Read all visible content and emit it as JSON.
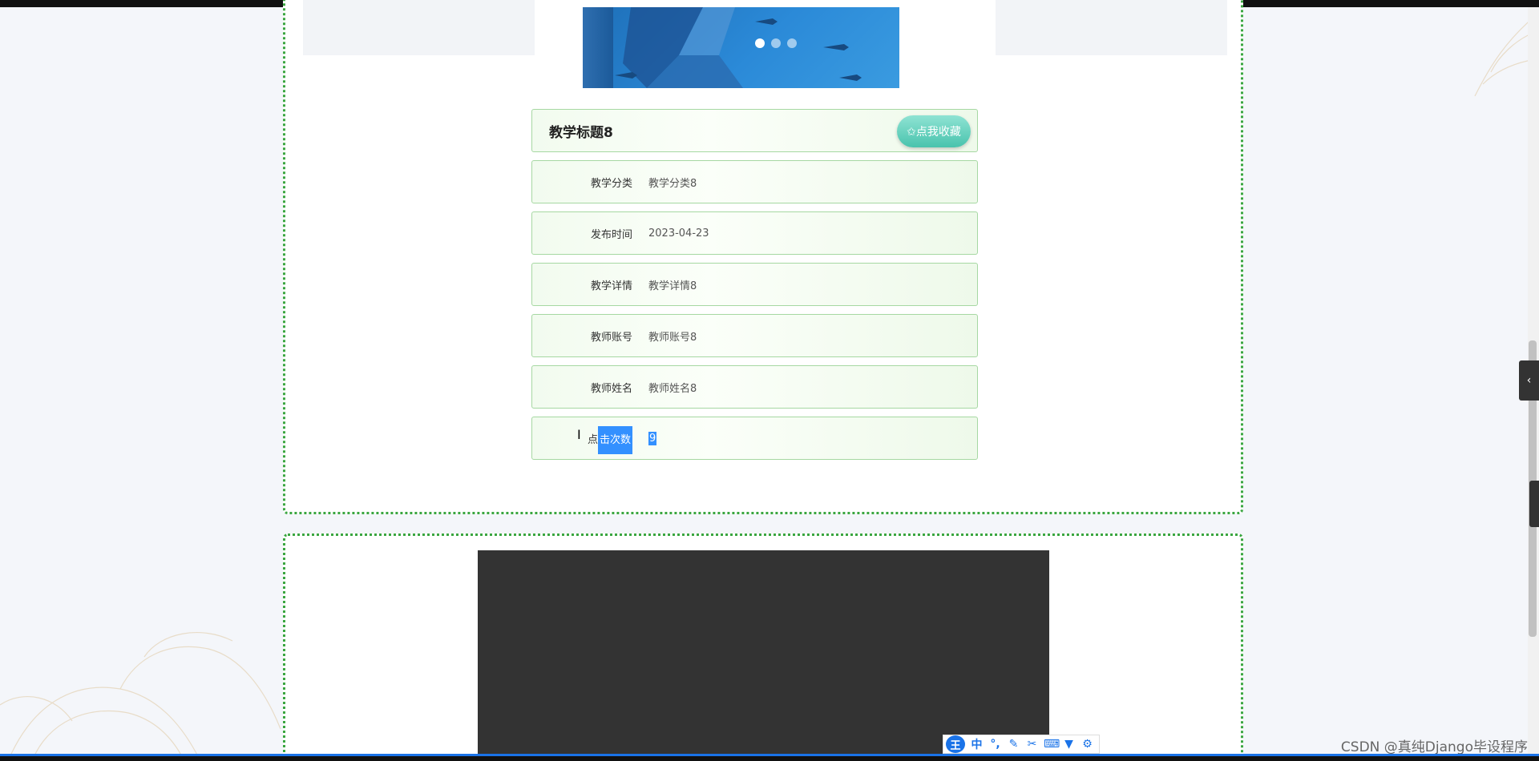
{
  "detail": {
    "title": "教学标题8",
    "favorite_button": "✩点我收藏",
    "fields": [
      {
        "label": "教学分类",
        "value": "教学分类8"
      },
      {
        "label": "发布时间",
        "value": "2023-04-23"
      },
      {
        "label": "教学详情",
        "value": "教学详情8"
      },
      {
        "label": "教师账号",
        "value": "教师账号8"
      },
      {
        "label": "教师姓名",
        "value": "教师姓名8"
      }
    ],
    "clicks": {
      "label_prefix": "点",
      "label_selected": "击次数",
      "value": "9"
    }
  },
  "carousel": {
    "slides": 3,
    "active": 1
  },
  "ime": {
    "main": "王",
    "lang": "中"
  },
  "watermark": "CSDN @真纯Django毕设程序",
  "colors": {
    "accent": "#3aa640",
    "button": "#49c3ad",
    "selection": "#3390ff"
  }
}
